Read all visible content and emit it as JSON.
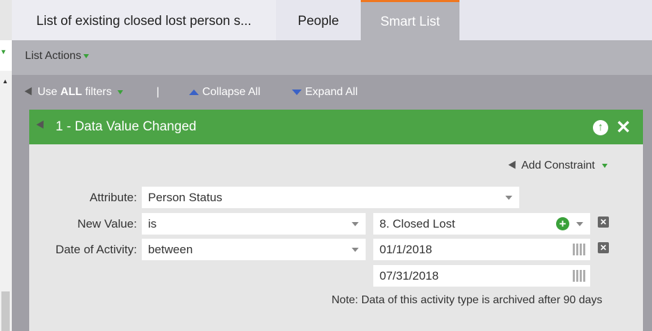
{
  "tabs": {
    "list": "List of existing closed lost person s...",
    "people": "People",
    "smart_list": "Smart List"
  },
  "actions": {
    "list_actions": "List Actions"
  },
  "toolbar": {
    "use_prefix": "Use",
    "use_all": "ALL",
    "use_suffix": "filters",
    "separator": "|",
    "collapse": "Collapse All",
    "expand": "Expand All"
  },
  "filter": {
    "title": "1 - Data Value Changed",
    "add_constraint": "Add Constraint",
    "labels": {
      "attribute": "Attribute:",
      "new_value": "New Value:",
      "date": "Date of Activity:"
    },
    "values": {
      "attribute": "Person Status",
      "new_value_op": "is",
      "new_value": "8. Closed Lost",
      "date_op": "between",
      "date_start": "01/1/2018",
      "date_end": "07/31/2018"
    },
    "note": "Note: Data of this activity type is archived after 90 days"
  },
  "colors": {
    "accent": "#f0771f",
    "header_green": "#4ca446",
    "expand_blue": "#3a62c6"
  }
}
